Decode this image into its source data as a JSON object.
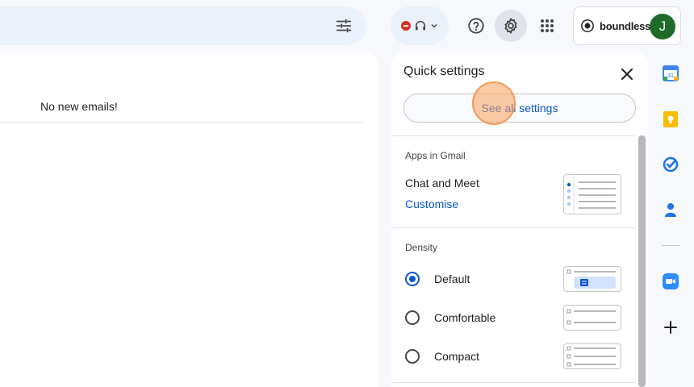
{
  "header": {
    "org_name": "boundless",
    "avatar_initial": "J"
  },
  "main": {
    "empty_message": "No new emails!"
  },
  "quick_settings": {
    "title": "Quick settings",
    "see_all_label": "See all settings",
    "apps_section_label": "Apps in Gmail",
    "chat_meet_label": "Chat and Meet",
    "customise_label": "Customise",
    "density_label": "Density",
    "density_options": [
      {
        "label": "Default",
        "selected": true
      },
      {
        "label": "Comfortable",
        "selected": false
      },
      {
        "label": "Compact",
        "selected": false
      }
    ]
  },
  "icons": {
    "search_options": "tune-icon",
    "status": "status-busy-icon",
    "headset": "headset-icon",
    "help": "help-icon",
    "settings": "gear-icon",
    "apps": "apps-grid-icon",
    "close": "close-icon",
    "rail": [
      "calendar-icon",
      "keep-icon",
      "tasks-icon",
      "contacts-icon",
      "zoom-icon",
      "add-icon"
    ]
  },
  "colors": {
    "accent": "#0b57d0",
    "avatar_bg": "#1e6b2a",
    "busy_red": "#d93025"
  }
}
